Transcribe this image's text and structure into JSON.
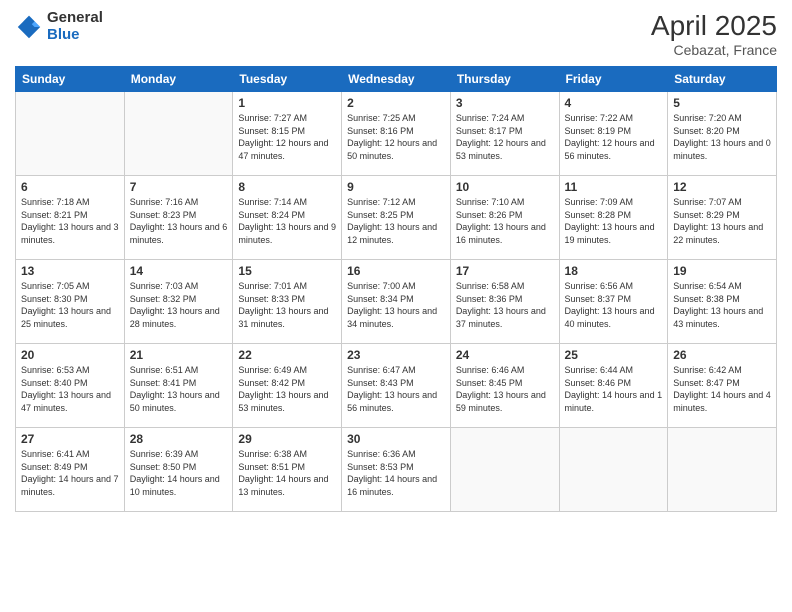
{
  "logo": {
    "general": "General",
    "blue": "Blue"
  },
  "title": {
    "month": "April 2025",
    "location": "Cebazat, France"
  },
  "days_header": [
    "Sunday",
    "Monday",
    "Tuesday",
    "Wednesday",
    "Thursday",
    "Friday",
    "Saturday"
  ],
  "weeks": [
    [
      {
        "day": "",
        "info": ""
      },
      {
        "day": "",
        "info": ""
      },
      {
        "day": "1",
        "info": "Sunrise: 7:27 AM\nSunset: 8:15 PM\nDaylight: 12 hours and 47 minutes."
      },
      {
        "day": "2",
        "info": "Sunrise: 7:25 AM\nSunset: 8:16 PM\nDaylight: 12 hours and 50 minutes."
      },
      {
        "day": "3",
        "info": "Sunrise: 7:24 AM\nSunset: 8:17 PM\nDaylight: 12 hours and 53 minutes."
      },
      {
        "day": "4",
        "info": "Sunrise: 7:22 AM\nSunset: 8:19 PM\nDaylight: 12 hours and 56 minutes."
      },
      {
        "day": "5",
        "info": "Sunrise: 7:20 AM\nSunset: 8:20 PM\nDaylight: 13 hours and 0 minutes."
      }
    ],
    [
      {
        "day": "6",
        "info": "Sunrise: 7:18 AM\nSunset: 8:21 PM\nDaylight: 13 hours and 3 minutes."
      },
      {
        "day": "7",
        "info": "Sunrise: 7:16 AM\nSunset: 8:23 PM\nDaylight: 13 hours and 6 minutes."
      },
      {
        "day": "8",
        "info": "Sunrise: 7:14 AM\nSunset: 8:24 PM\nDaylight: 13 hours and 9 minutes."
      },
      {
        "day": "9",
        "info": "Sunrise: 7:12 AM\nSunset: 8:25 PM\nDaylight: 13 hours and 12 minutes."
      },
      {
        "day": "10",
        "info": "Sunrise: 7:10 AM\nSunset: 8:26 PM\nDaylight: 13 hours and 16 minutes."
      },
      {
        "day": "11",
        "info": "Sunrise: 7:09 AM\nSunset: 8:28 PM\nDaylight: 13 hours and 19 minutes."
      },
      {
        "day": "12",
        "info": "Sunrise: 7:07 AM\nSunset: 8:29 PM\nDaylight: 13 hours and 22 minutes."
      }
    ],
    [
      {
        "day": "13",
        "info": "Sunrise: 7:05 AM\nSunset: 8:30 PM\nDaylight: 13 hours and 25 minutes."
      },
      {
        "day": "14",
        "info": "Sunrise: 7:03 AM\nSunset: 8:32 PM\nDaylight: 13 hours and 28 minutes."
      },
      {
        "day": "15",
        "info": "Sunrise: 7:01 AM\nSunset: 8:33 PM\nDaylight: 13 hours and 31 minutes."
      },
      {
        "day": "16",
        "info": "Sunrise: 7:00 AM\nSunset: 8:34 PM\nDaylight: 13 hours and 34 minutes."
      },
      {
        "day": "17",
        "info": "Sunrise: 6:58 AM\nSunset: 8:36 PM\nDaylight: 13 hours and 37 minutes."
      },
      {
        "day": "18",
        "info": "Sunrise: 6:56 AM\nSunset: 8:37 PM\nDaylight: 13 hours and 40 minutes."
      },
      {
        "day": "19",
        "info": "Sunrise: 6:54 AM\nSunset: 8:38 PM\nDaylight: 13 hours and 43 minutes."
      }
    ],
    [
      {
        "day": "20",
        "info": "Sunrise: 6:53 AM\nSunset: 8:40 PM\nDaylight: 13 hours and 47 minutes."
      },
      {
        "day": "21",
        "info": "Sunrise: 6:51 AM\nSunset: 8:41 PM\nDaylight: 13 hours and 50 minutes."
      },
      {
        "day": "22",
        "info": "Sunrise: 6:49 AM\nSunset: 8:42 PM\nDaylight: 13 hours and 53 minutes."
      },
      {
        "day": "23",
        "info": "Sunrise: 6:47 AM\nSunset: 8:43 PM\nDaylight: 13 hours and 56 minutes."
      },
      {
        "day": "24",
        "info": "Sunrise: 6:46 AM\nSunset: 8:45 PM\nDaylight: 13 hours and 59 minutes."
      },
      {
        "day": "25",
        "info": "Sunrise: 6:44 AM\nSunset: 8:46 PM\nDaylight: 14 hours and 1 minute."
      },
      {
        "day": "26",
        "info": "Sunrise: 6:42 AM\nSunset: 8:47 PM\nDaylight: 14 hours and 4 minutes."
      }
    ],
    [
      {
        "day": "27",
        "info": "Sunrise: 6:41 AM\nSunset: 8:49 PM\nDaylight: 14 hours and 7 minutes."
      },
      {
        "day": "28",
        "info": "Sunrise: 6:39 AM\nSunset: 8:50 PM\nDaylight: 14 hours and 10 minutes."
      },
      {
        "day": "29",
        "info": "Sunrise: 6:38 AM\nSunset: 8:51 PM\nDaylight: 14 hours and 13 minutes."
      },
      {
        "day": "30",
        "info": "Sunrise: 6:36 AM\nSunset: 8:53 PM\nDaylight: 14 hours and 16 minutes."
      },
      {
        "day": "",
        "info": ""
      },
      {
        "day": "",
        "info": ""
      },
      {
        "day": "",
        "info": ""
      }
    ]
  ]
}
